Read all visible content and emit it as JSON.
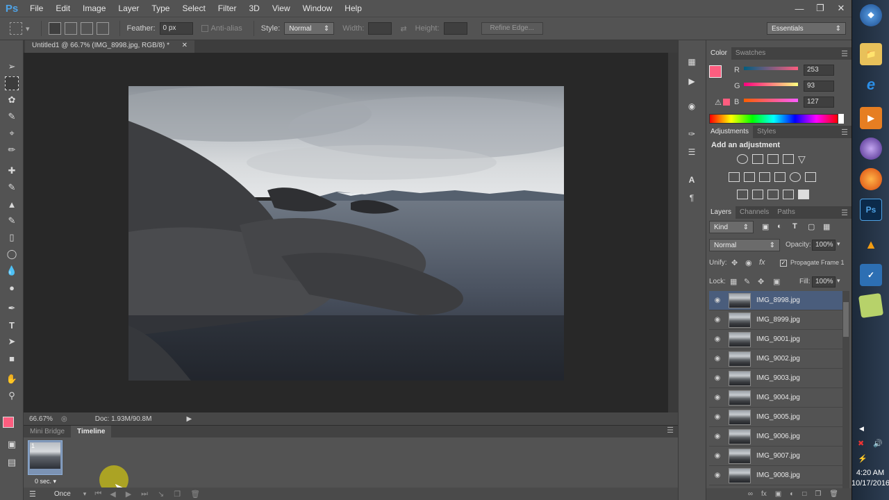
{
  "app": {
    "name": "Photoshop",
    "logo": "Ps"
  },
  "menu": [
    "File",
    "Edit",
    "Image",
    "Layer",
    "Type",
    "Select",
    "Filter",
    "3D",
    "View",
    "Window",
    "Help"
  ],
  "window_controls": [
    "minimize-icon",
    "restore-icon",
    "close-icon"
  ],
  "options": {
    "feather_label": "Feather:",
    "feather_value": "0 px",
    "antialias_label": "Anti-alias",
    "style_label": "Style:",
    "style_value": "Normal",
    "width_label": "Width:",
    "height_label": "Height:",
    "refine_edge": "Refine Edge...",
    "workspace": "Essentials"
  },
  "document": {
    "tab_title": "Untitled1 @ 66.7% (IMG_8998.jpg, RGB/8) *",
    "zoom": "66.67%",
    "doc_info": "Doc: 1.93M/90.8M"
  },
  "timeline": {
    "tabs": [
      "Mini Bridge",
      "Timeline"
    ],
    "active_tab": "Timeline",
    "frame_number": "1",
    "frame_delay": "0 sec.",
    "loop": "Once"
  },
  "color_panel": {
    "tabs": [
      "Color",
      "Swatches"
    ],
    "r_label": "R",
    "g_label": "G",
    "b_label": "B",
    "r": "253",
    "g": "93",
    "b": "127",
    "foreground": "#fd5d7f"
  },
  "adjustments_panel": {
    "tabs": [
      "Adjustments",
      "Styles"
    ],
    "heading": "Add an adjustment"
  },
  "layers_panel": {
    "tabs": [
      "Layers",
      "Channels",
      "Paths"
    ],
    "filter_kind": "Kind",
    "blend_mode": "Normal",
    "opacity_label": "Opacity:",
    "opacity": "100%",
    "unify_label": "Unify:",
    "propagate_label": "Propagate Frame 1",
    "lock_label": "Lock:",
    "fill_label": "Fill:",
    "fill": "100%",
    "layers": [
      "IMG_8998.jpg",
      "IMG_8999.jpg",
      "IMG_9001.jpg",
      "IMG_9002.jpg",
      "IMG_9003.jpg",
      "IMG_9004.jpg",
      "IMG_9005.jpg",
      "IMG_9006.jpg",
      "IMG_9007.jpg",
      "IMG_9008.jpg"
    ],
    "selected_layer": "IMG_8998.jpg"
  },
  "taskbar": {
    "apps": [
      "windows-start-icon",
      "file-explorer-icon",
      "internet-explorer-icon",
      "media-player-icon",
      "media-center-icon",
      "firefox-icon",
      "photoshop-icon",
      "vlc-icon",
      "app-icon",
      "notes-icon"
    ],
    "time": "4:20 AM",
    "date": "10/17/2016"
  }
}
